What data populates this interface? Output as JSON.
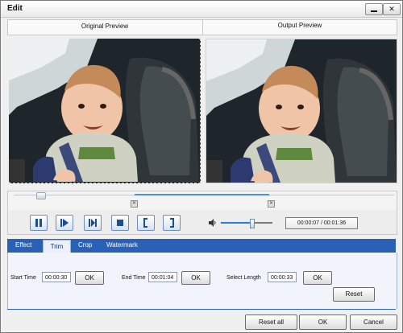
{
  "window": {
    "title": "Edit"
  },
  "preview": {
    "original_label": "Original Preview",
    "output_label": "Output Preview"
  },
  "playback": {
    "time": "00:00:07 / 00:01:36",
    "volume_level": 0.58,
    "position_fraction": 0.07,
    "trim_start_fraction": 0.32,
    "trim_end_fraction": 0.67
  },
  "tabs": [
    {
      "label": "Effect",
      "active": false
    },
    {
      "label": "Trim",
      "active": true
    },
    {
      "label": "Crop",
      "active": false
    },
    {
      "label": "Watermark",
      "active": false
    }
  ],
  "trim": {
    "start_label": "Start Time",
    "start_value": "00:00:30",
    "end_label": "End Time",
    "end_value": "00:01:04",
    "length_label": "Select Length",
    "length_value": "00:00:33",
    "ok_label": "OK",
    "reset_label": "Reset"
  },
  "footer": {
    "reset_all": "Reset all",
    "ok": "OK",
    "cancel": "Cancel"
  },
  "colors": {
    "tab_bar": "#2a61b7",
    "accent": "#4a90e2"
  }
}
